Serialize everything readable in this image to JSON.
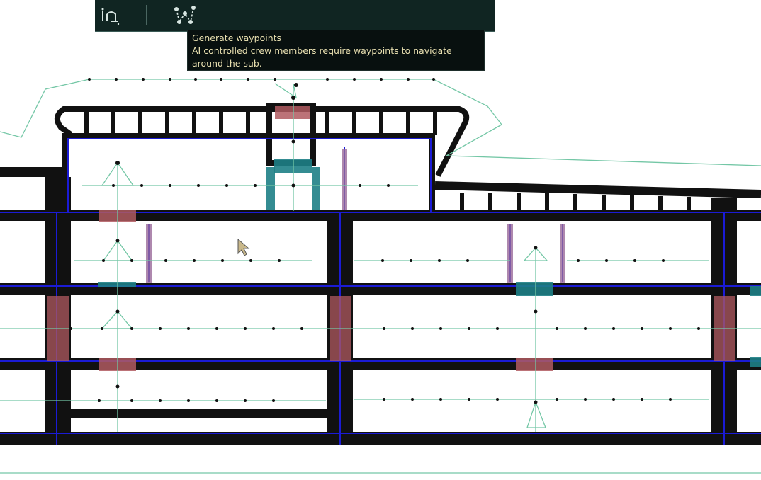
{
  "toolbar": {
    "tools": [
      {
        "id": "link-waypoints",
        "icon": "waypoint-link-icon"
      },
      {
        "id": "generate-waypoints",
        "icon": "generate-waypoints-icon"
      }
    ]
  },
  "tooltip": {
    "title": "Generate waypoints",
    "line1": "AI controlled crew members require waypoints to navigate",
    "line2": "around the sub."
  },
  "colors": {
    "hull": "#111111",
    "hull_outline": "#1b1bd6",
    "waypoint_path": "#74c7a6",
    "door": "#b05a60",
    "hatch": "#1e7f86",
    "toolbar_bg": "#102522",
    "tooltip_text": "#e8dfb0"
  }
}
